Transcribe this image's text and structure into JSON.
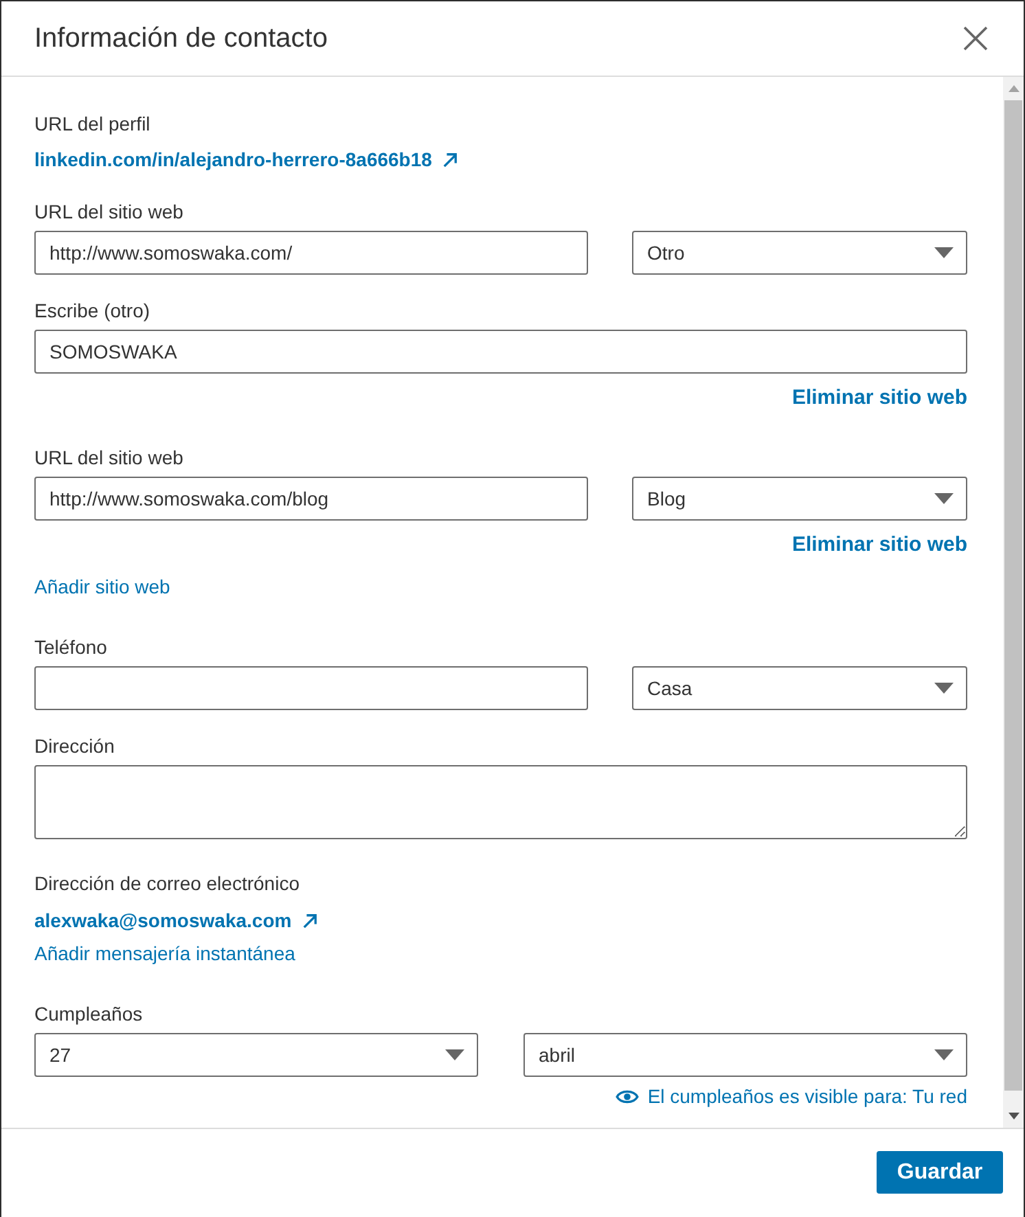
{
  "dialog": {
    "title": "Información de contacto"
  },
  "profile_url": {
    "label": "URL del perfil",
    "link": "linkedin.com/in/alejandro-herrero-8a666b18"
  },
  "websites": [
    {
      "label": "URL del sitio web",
      "url": "http://www.somoswaka.com/",
      "type": "Otro",
      "other_label": "Escribe (otro)",
      "other_value": "SOMOSWAKA",
      "remove_link": "Eliminar sitio web"
    },
    {
      "label": "URL del sitio web",
      "url": "http://www.somoswaka.com/blog",
      "type": "Blog",
      "remove_link": "Eliminar sitio web"
    }
  ],
  "add_website_link": "Añadir sitio web",
  "phone": {
    "label": "Teléfono",
    "type": "Casa"
  },
  "address": {
    "label": "Dirección"
  },
  "email": {
    "label": "Dirección de correo electrónico",
    "link": "alexwaka@somoswaka.com",
    "add_im_link": "Añadir mensajería instantánea"
  },
  "birthday": {
    "label": "Cumpleaños",
    "day": "27",
    "month": "abril",
    "visibility": "El cumpleaños es visible para: Tu red"
  },
  "footer": {
    "save_button": "Guardar"
  }
}
